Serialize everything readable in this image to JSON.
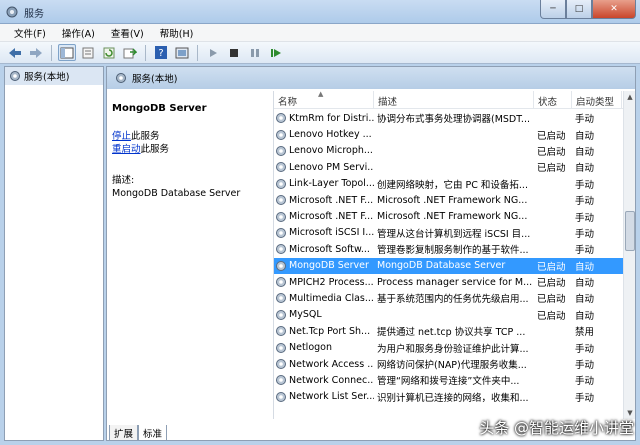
{
  "window": {
    "title": "服务",
    "minimize": "─",
    "maximize": "□",
    "close": "✕"
  },
  "menu": [
    "文件(F)",
    "操作(A)",
    "查看(V)",
    "帮助(H)"
  ],
  "tree": {
    "root_label": "服务(本地)"
  },
  "panel": {
    "header": "服务(本地)"
  },
  "details": {
    "service_name": "MongoDB Server",
    "stop_link": "停止",
    "stop_suffix": "此服务",
    "restart_link": "重启动",
    "restart_suffix": "此服务",
    "desc_label": "描述:",
    "desc_text": "MongoDB Database Server"
  },
  "columns": {
    "name": "名称",
    "desc": "描述",
    "status": "状态",
    "start": "启动类型"
  },
  "rows": [
    {
      "name": "KtmRm for Distri...",
      "desc": "协调分布式事务处理协调器(MSDT...",
      "status": "",
      "start": "手动"
    },
    {
      "name": "Lenovo Hotkey ...",
      "desc": "",
      "status": "已启动",
      "start": "自动"
    },
    {
      "name": "Lenovo Microph...",
      "desc": "",
      "status": "已启动",
      "start": "自动"
    },
    {
      "name": "Lenovo PM Servi...",
      "desc": "",
      "status": "已启动",
      "start": "自动"
    },
    {
      "name": "Link-Layer Topol...",
      "desc": "创建网络映射，它由 PC 和设备拓...",
      "status": "",
      "start": "手动"
    },
    {
      "name": "Microsoft .NET F...",
      "desc": "Microsoft .NET Framework NG...",
      "status": "",
      "start": "手动"
    },
    {
      "name": "Microsoft .NET F...",
      "desc": "Microsoft .NET Framework NG...",
      "status": "",
      "start": "手动"
    },
    {
      "name": "Microsoft iSCSI I...",
      "desc": "管理从这台计算机到远程 iSCSI 目...",
      "status": "",
      "start": "手动"
    },
    {
      "name": "Microsoft Softw...",
      "desc": "管理卷影复制服务制作的基于软件...",
      "status": "",
      "start": "手动"
    },
    {
      "name": "MongoDB Server",
      "desc": "MongoDB Database Server",
      "status": "已启动",
      "start": "自动",
      "selected": true
    },
    {
      "name": "MPICH2 Process...",
      "desc": "Process manager service for M...",
      "status": "已启动",
      "start": "自动"
    },
    {
      "name": "Multimedia Clas...",
      "desc": "基于系统范围内的任务优先级启用...",
      "status": "已启动",
      "start": "自动"
    },
    {
      "name": "MySQL",
      "desc": "",
      "status": "已启动",
      "start": "自动"
    },
    {
      "name": "Net.Tcp Port Sh...",
      "desc": "提供通过 net.tcp 协议共享 TCP ...",
      "status": "",
      "start": "禁用"
    },
    {
      "name": "Netlogon",
      "desc": "为用户和服务身份验证维护此计算...",
      "status": "",
      "start": "手动"
    },
    {
      "name": "Network Access ...",
      "desc": "网络访问保护(NAP)代理服务收集...",
      "status": "",
      "start": "手动"
    },
    {
      "name": "Network Connec...",
      "desc": "管理“网络和拨号连接”文件夹中...",
      "status": "",
      "start": "手动"
    },
    {
      "name": "Network List Ser...",
      "desc": "识别计算机已连接的网络，收集和...",
      "status": "",
      "start": "手动"
    }
  ],
  "tabs": [
    "扩展",
    "标准"
  ],
  "watermark": "头条 @智能运维小讲堂",
  "colors": {
    "selection": "#3399ff",
    "link": "#0033cc",
    "header_band": "#b6cde6"
  },
  "icons": [
    "back-icon",
    "forward-icon",
    "console-tree-icon",
    "properties-icon",
    "refresh-icon",
    "export-icon",
    "help-icon",
    "mmc-icon",
    "play-icon",
    "stop-icon",
    "pause-icon",
    "restart-icon",
    "gear-icon"
  ]
}
